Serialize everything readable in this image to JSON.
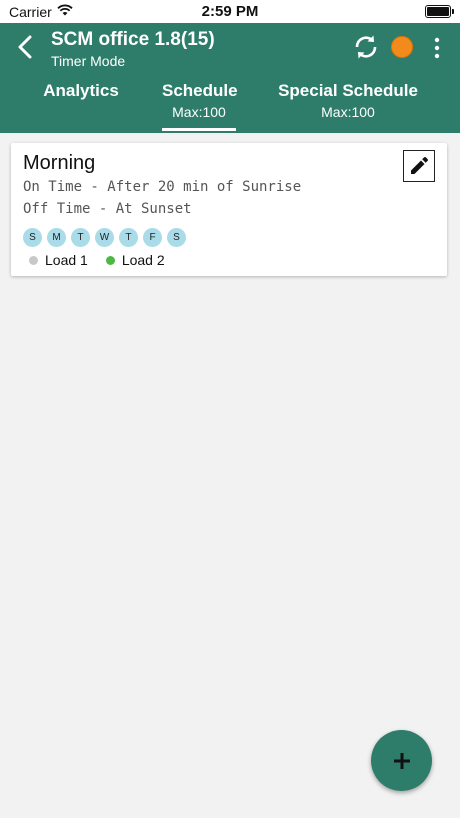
{
  "status_bar": {
    "carrier": "Carrier",
    "time": "2:59 PM"
  },
  "header": {
    "title": "SCM office 1.8(15)",
    "subtitle": "Timer Mode",
    "status_color": "#f28a1c",
    "background_color": "#2e7d6b"
  },
  "tabs": [
    {
      "label": "Analytics",
      "sub": ""
    },
    {
      "label": "Schedule",
      "sub": "Max:100",
      "selected": true
    },
    {
      "label": "Special Schedule",
      "sub": "Max:100"
    }
  ],
  "schedule_card": {
    "title": "Morning",
    "on_time": "On Time - After 20 min of Sunrise",
    "off_time": "Off Time - At Sunset",
    "days": [
      "S",
      "M",
      "T",
      "W",
      "T",
      "F",
      "S"
    ],
    "loads": [
      {
        "label": "Load 1",
        "color": "#c8c8c8"
      },
      {
        "label": "Load 2",
        "color": "#4cb944"
      }
    ]
  },
  "icons": {
    "back": "chevron-left-icon",
    "refresh": "refresh-icon",
    "more": "more-vertical-icon",
    "edit": "pencil-icon",
    "add": "plus-icon"
  }
}
